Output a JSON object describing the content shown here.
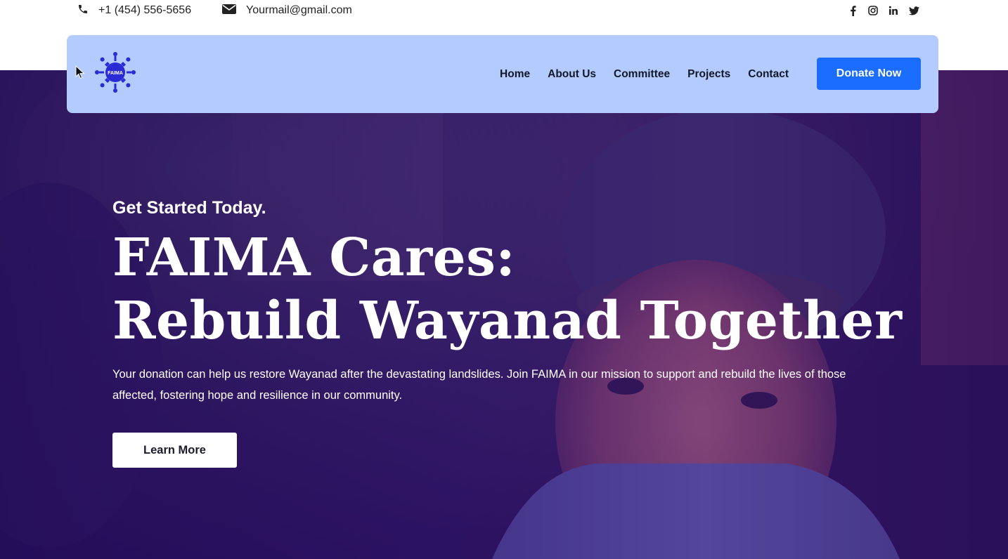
{
  "contact": {
    "phone": "+1 (454) 556-5656",
    "email": "Yourmail@gmail.com",
    "phone_icon": "phone-icon",
    "email_icon": "envelope-icon"
  },
  "social": {
    "icons": [
      "facebook-icon",
      "instagram-icon",
      "linkedin-icon",
      "twitter-icon"
    ]
  },
  "nav": {
    "logo_text": "FAIMA",
    "items": [
      "Home",
      "About Us",
      "Committee",
      "Projects",
      "Contact"
    ],
    "donate_label": "Donate Now"
  },
  "hero": {
    "kicker": "Get Started Today.",
    "title_line1": "FAIMA Cares:",
    "title_line2": "Rebuild Wayanad Together",
    "description": "Your donation can help us restore Wayanad after the devastating landslides. Join FAIMA in our mission to support and rebuild the lives of those affected, fostering hope and resilience in our community.",
    "cta_label": "Learn More"
  },
  "colors": {
    "nav_background": "#b3cbff",
    "donate_button": "#1a6dff",
    "logo_blue": "#2b2bd6",
    "hero_overlay": "#2a1457"
  }
}
